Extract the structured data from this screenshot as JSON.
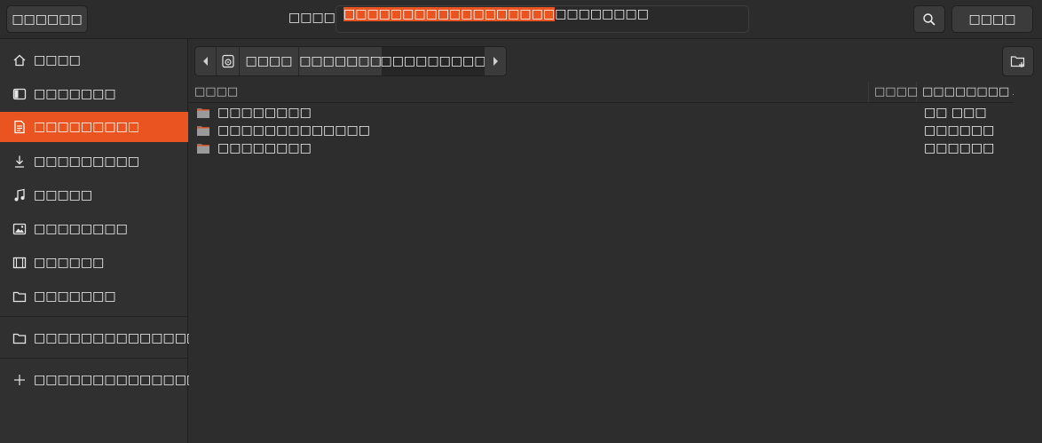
{
  "header": {
    "cancel_label": "□□□□□□",
    "name_label": "□□□□",
    "name_value_selected": "□□□□□□□□□□□□□□□□□□",
    "name_value_rest": "□□□□□□□□",
    "open_label": "□□□□"
  },
  "sidebar": {
    "items": [
      {
        "label": "□□□□",
        "icon": "home-icon"
      },
      {
        "label": "□□□□□□□",
        "icon": "desktop-icon"
      },
      {
        "label": "□□□□□□□□□",
        "icon": "document-icon",
        "active": true
      },
      {
        "label": "□□□□□□□□□",
        "icon": "download-icon"
      },
      {
        "label": "□□□□□",
        "icon": "music-icon"
      },
      {
        "label": "□□□□□□□□",
        "icon": "picture-icon"
      },
      {
        "label": "□□□□□□",
        "icon": "video-icon"
      },
      {
        "label": "□□□□□□□",
        "icon": "folder-icon"
      },
      {
        "label": "□□□□□□□□□□□□□□",
        "icon": "folder-icon"
      },
      {
        "label": "□□□□□□□□□□□□□□□",
        "icon": "plus-icon"
      }
    ]
  },
  "pathbar": {
    "crumbs": [
      "□□□□",
      "□□□□□□□",
      "□□□□□□□□□"
    ]
  },
  "list": {
    "columns": {
      "name": "□□□□",
      "size": "□□□□",
      "modified": "□□□□□□□□"
    },
    "rows": [
      {
        "name": "□□□□□□□□",
        "modified": "□□ □□□"
      },
      {
        "name": "□□□□□□□□□□□□□",
        "modified": "□□□□□□"
      },
      {
        "name": "□□□□□□□□",
        "modified": "□□□□□□"
      }
    ]
  },
  "colors": {
    "accent": "#e95420",
    "folder": "#e95420"
  }
}
